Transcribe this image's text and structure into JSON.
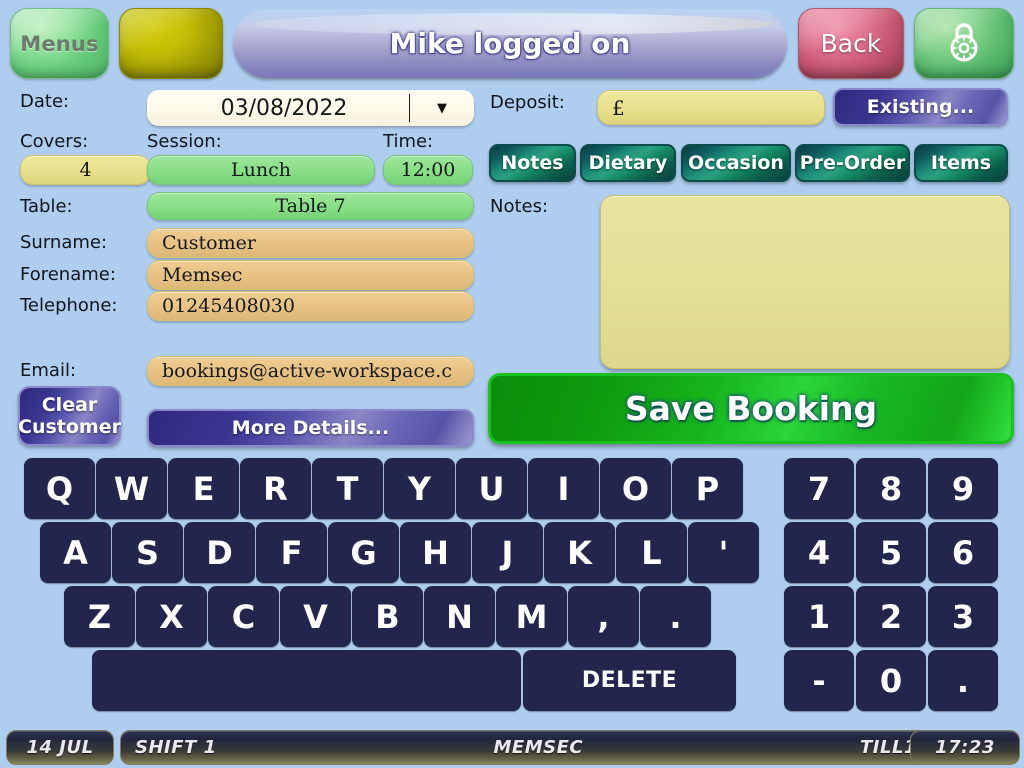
{
  "header": {
    "menus_label": "Menus",
    "blank_label": "",
    "banner_text": "Mike logged on",
    "back_label": "Back",
    "lock_icon": "padlock-icon"
  },
  "form": {
    "date_label": "Date:",
    "date_value": "03/08/2022",
    "date_arrow": "▼",
    "covers_label": "Covers:",
    "covers_value": "4",
    "session_label": "Session:",
    "session_value": "Lunch",
    "time_label": "Time:",
    "time_value": "12:00",
    "table_label": "Table:",
    "table_value": "Table 7",
    "surname_label": "Surname:",
    "surname_value": "Customer",
    "forename_label": "Forename:",
    "forename_value": "Memsec",
    "telephone_label": "Telephone:",
    "telephone_value": "01245408030",
    "email_label": "Email:",
    "email_value": "bookings@active-workspace.c",
    "clear_customer_label": "Clear\nCustomer",
    "clear_customer_line1": "Clear",
    "clear_customer_line2": "Customer",
    "more_details_label": "More Details..."
  },
  "right_panel": {
    "deposit_label": "Deposit:",
    "deposit_value": "£",
    "existing_label": "Existing...",
    "tabs": [
      {
        "label": "Notes",
        "name": "tab-notes"
      },
      {
        "label": "Dietary",
        "name": "tab-dietary"
      },
      {
        "label": "Occasion",
        "name": "tab-occasion"
      },
      {
        "label": "Pre-Order",
        "name": "tab-preorder"
      },
      {
        "label": "Items",
        "name": "tab-items"
      }
    ],
    "notes_label": "Notes:",
    "notes_value": "",
    "save_booking_label": "Save Booking"
  },
  "keyboard": {
    "row1": [
      "Q",
      "W",
      "E",
      "R",
      "T",
      "Y",
      "U",
      "I",
      "O",
      "P"
    ],
    "row2": [
      "A",
      "S",
      "D",
      "F",
      "G",
      "H",
      "J",
      "K",
      "L",
      "'"
    ],
    "row3": [
      "Z",
      "X",
      "C",
      "V",
      "B",
      "N",
      "M",
      ",",
      "."
    ],
    "space_label": "",
    "delete_label": "DELETE",
    "numpad": [
      [
        "7",
        "8",
        "9"
      ],
      [
        "4",
        "5",
        "6"
      ],
      [
        "1",
        "2",
        "3"
      ],
      [
        "-",
        "0",
        "."
      ]
    ]
  },
  "statusbar": {
    "date": "14 JUL",
    "shift": "SHIFT 1",
    "user": "MEMSEC",
    "till": "TILL1",
    "time": "17:23"
  },
  "colors": {
    "background": "#afcdee",
    "key": "#23254c",
    "accent_green": "#17b51d",
    "tab_teal": "#1d8d79",
    "purple": "#5a56ad"
  }
}
